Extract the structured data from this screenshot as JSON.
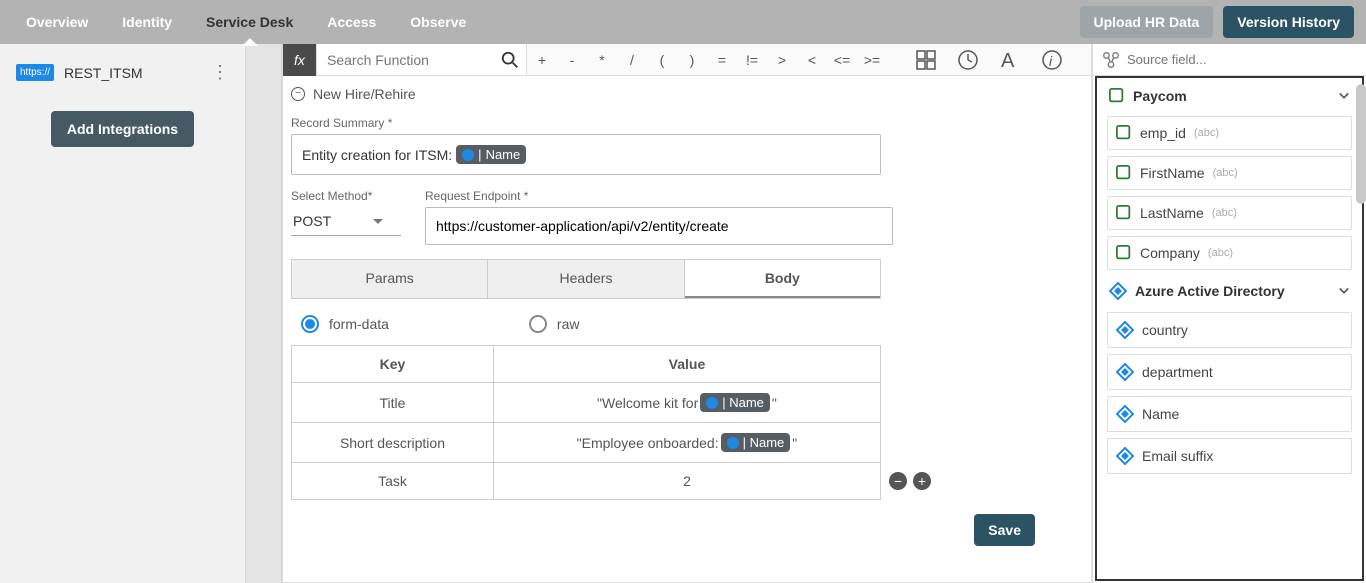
{
  "nav": {
    "items": [
      "Overview",
      "Identity",
      "Service Desk",
      "Access",
      "Observe"
    ],
    "activeIndex": 2,
    "upload": "Upload HR Data",
    "version": "Version History"
  },
  "sidebar": {
    "integration": {
      "tag": "https://",
      "name": "REST_ITSM"
    },
    "addButton": "Add Integrations"
  },
  "fx": {
    "searchPlaceholder": "Search Function",
    "ops": [
      "+",
      "-",
      "*",
      "/",
      "(",
      ")",
      "=",
      "!=",
      ">",
      "<",
      "<=",
      ">="
    ]
  },
  "form": {
    "groupTitle": "New Hire/Rehire",
    "recordSummaryLabel": "Record Summary *",
    "recordSummaryPrefix": "Entity creation for ITSM:",
    "pillName": "Name",
    "selectMethodLabel": "Select Method*",
    "selectMethodValue": "POST",
    "endpointLabel": "Request Endpoint *",
    "endpointValue": "https://customer-application/api/v2/entity/create",
    "tabs": [
      "Params",
      "Headers",
      "Body"
    ],
    "activeTab": 2,
    "radios": {
      "formData": "form-data",
      "raw": "raw",
      "selected": "form-data"
    },
    "tableHeaders": [
      "Key",
      "Value"
    ],
    "rows": [
      {
        "key": "Title",
        "prefix": "\"Welcome kit for",
        "pill": "Name",
        "suffix": "\""
      },
      {
        "key": "Short description",
        "prefix": "\"Employee onboarded:",
        "pill": "Name",
        "suffix": "\""
      },
      {
        "key": "Task",
        "value": "2"
      }
    ],
    "save": "Save"
  },
  "sources": {
    "placeholder": "Source field...",
    "groups": [
      {
        "name": "Paycom",
        "icon": "paycom",
        "fields": [
          {
            "name": "emp_id",
            "type": "(abc)"
          },
          {
            "name": "FirstName",
            "type": "(abc)"
          },
          {
            "name": "LastName",
            "type": "(abc)"
          },
          {
            "name": "Company",
            "type": "(abc)"
          }
        ]
      },
      {
        "name": "Azure Active Directory",
        "icon": "aad",
        "fields": [
          {
            "name": "country"
          },
          {
            "name": "department"
          },
          {
            "name": "Name"
          },
          {
            "name": "Email suffix"
          }
        ]
      }
    ]
  }
}
